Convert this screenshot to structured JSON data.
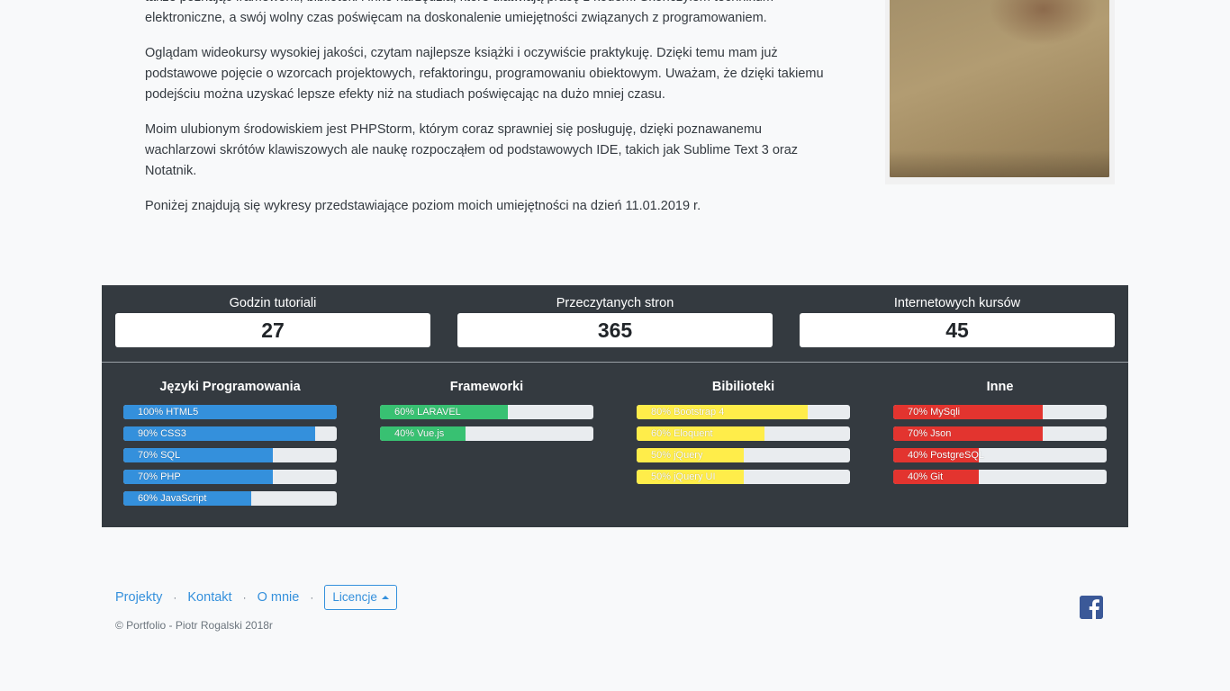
{
  "intro": {
    "p1": "także poznając frameworki, biblioteki i inne narzędzia, które ułatwiają pracę z kodem. Skończyłem technikum elektroniczne, a swój wolny czas poświęcam na doskonalenie umiejętności związanych z programowaniem.",
    "p2": "Oglądam wideokursy wysokiej jakości, czytam najlepsze książki i oczywiście praktykuję. Dzięki temu mam już podstawowe pojęcie o wzorcach projektowych, refaktoringu, programowaniu obiektowym. Uważam, że dzięki takiemu podejściu można uzyskać lepsze efekty niż na studiach poświęcając na dużo mniej czasu.",
    "p3": "Moim ulubionym środowiskiem jest PHPStorm, którym coraz sprawniej się posługuję, dzięki poznawanemu wachlarzowi skrótów klawiszowych ale naukę rozpocząłem od podstawowych IDE, takich jak Sublime Text 3 oraz Notatnik.",
    "p4": "Poniżej znajdują się wykresy przedstawiające poziom moich umiejętności na dzień 11.01.2019 r."
  },
  "stats": [
    {
      "label": "Godzin tutoriali",
      "value": "27"
    },
    {
      "label": "Przeczytanych stron",
      "value": "365"
    },
    {
      "label": "Internetowych kursów",
      "value": "45"
    }
  ],
  "skills": [
    {
      "title": "Języki Programowania",
      "color": "#3490dc",
      "items": [
        {
          "label": "100% HTML5",
          "percent": 100
        },
        {
          "label": "90% CSS3",
          "percent": 90
        },
        {
          "label": "70% SQL",
          "percent": 70
        },
        {
          "label": "70% PHP",
          "percent": 70
        },
        {
          "label": "60% JavaScript",
          "percent": 60
        }
      ]
    },
    {
      "title": "Frameworki",
      "color": "#38c172",
      "items": [
        {
          "label": "60% LARAVEL",
          "percent": 60
        },
        {
          "label": "40% Vue.js",
          "percent": 40
        }
      ]
    },
    {
      "title": "Bibilioteki",
      "color": "#ffed4a",
      "items": [
        {
          "label": "80% Bootstrap 4",
          "percent": 80
        },
        {
          "label": "60% Eloquent",
          "percent": 60
        },
        {
          "label": "50% jQuery",
          "percent": 50
        },
        {
          "label": "50% jQuery UI",
          "percent": 50
        }
      ]
    },
    {
      "title": "Inne",
      "color": "#e3342f",
      "items": [
        {
          "label": "70% MySqli",
          "percent": 70
        },
        {
          "label": "70% Json",
          "percent": 70
        },
        {
          "label": "40% PostgreSQL",
          "percent": 40
        },
        {
          "label": "40% Git",
          "percent": 40
        }
      ]
    }
  ],
  "footer": {
    "links": [
      "Projekty",
      "Kontakt",
      "O mnie"
    ],
    "separator": "·",
    "license_label": "Licencje",
    "copyright": "© Portfolio - Piotr Rogalski 2018r",
    "social_icon": "facebook-icon"
  }
}
